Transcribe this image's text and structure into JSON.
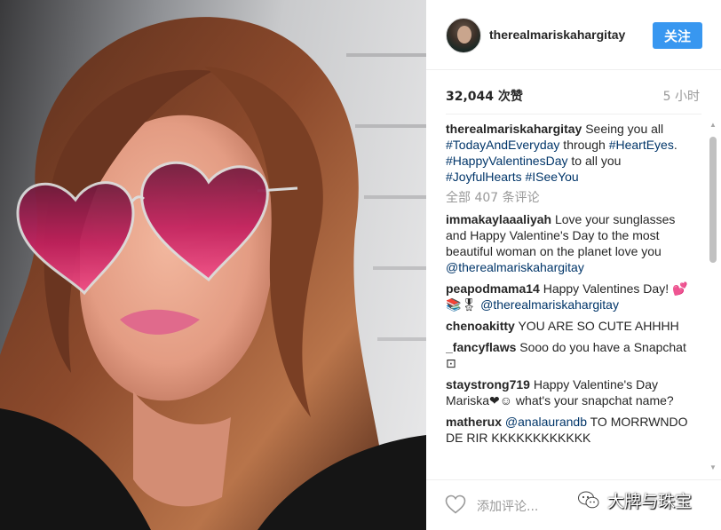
{
  "post": {
    "username": "therealmariskahargitay",
    "follow_label": "关注",
    "likes": "32,044 次赞",
    "time": "5 小时"
  },
  "caption": {
    "user": "therealmariskahargitay",
    "text_1": " Seeing you all ",
    "tag_1": "#TodayAndEveryday",
    "text_2": " through ",
    "tag_2": "#HeartEyes",
    "text_3": ". ",
    "tag_3": "#HappyValentinesDay",
    "text_4": " to all you ",
    "tag_4": "#JoyfulHearts",
    "text_5": " ",
    "tag_5": "#ISeeYou"
  },
  "view_all": "全部 407 条评论",
  "comments": [
    {
      "user": "immakaylaaaliyah",
      "text": " Love your sunglasses and Happy Valentine's Day to the most beautiful woman on the planet love you ",
      "mention": "@therealmariskahargitay"
    },
    {
      "user": "peapodmama14",
      "text": " Happy Valentines Day! 💕📚🎖 ",
      "mention": "@therealmariskahargitay"
    },
    {
      "user": "chenoakitty",
      "text": " YOU ARE SO CUTE AHHHH",
      "mention": ""
    },
    {
      "user": "_fancyflaws",
      "text": " Sooo do you have a Snapchat ⊡",
      "mention": ""
    },
    {
      "user": "staystrong719",
      "text": " Happy Valentine's Day Mariska❤☺ what's your snapchat name?",
      "mention": ""
    },
    {
      "user": "matherux",
      "text": " TO MORRWNDO DE RIR KKKKKKKKKKKK",
      "mention": "@analaurandb",
      "mention_first": true
    }
  ],
  "footer": {
    "add_comment_placeholder": "添加评论..."
  },
  "watermark": {
    "text": "大牌与珠宝"
  },
  "colors": {
    "accent": "#3897f0",
    "hashtag": "#003569",
    "muted": "#999999"
  }
}
